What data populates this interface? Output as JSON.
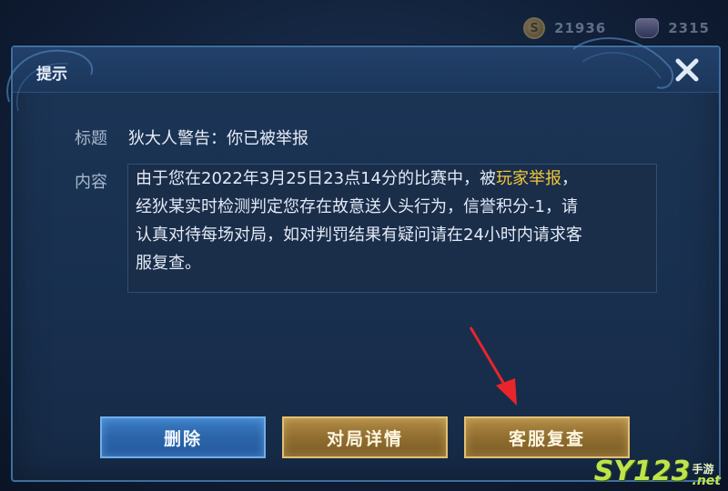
{
  "topbar": {
    "coins": {
      "icon": "coin-icon",
      "value": "21936"
    },
    "gems": {
      "icon": "gem-icon",
      "value": "2315"
    }
  },
  "dialog": {
    "title": "提示",
    "close_icon": "close-icon",
    "subject_label": "标题",
    "subject_value": "狄大人警告：你已被举报",
    "content_label": "内容",
    "content": {
      "part1": "由于您在2022年3月25日23点14分的比赛中，被",
      "highlight": "玩家举报",
      "part2": "，",
      "line2": "经狄某实时检测判定您存在故意送人头行为，信誉积分-1，请",
      "line3": "认真对待每场对局，如对判罚结果有疑问请在24小时内请求客",
      "line4": "服复查。"
    },
    "buttons": {
      "delete": "删除",
      "match_details": "对局详情",
      "appeal": "客服复查"
    }
  },
  "watermark": {
    "main": "SY123",
    "cn": "手游",
    "net": ".net"
  },
  "colors": {
    "highlight": "#f2c73a",
    "arrow": "#e8252b",
    "button_blue": "#2b65a8",
    "button_gold": "#8e6c2f"
  }
}
